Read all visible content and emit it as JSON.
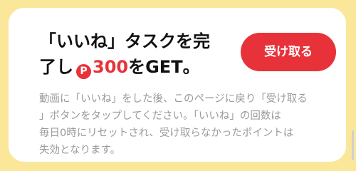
{
  "task": {
    "title_line1": "「いいね」タスクを完",
    "title_line2_prefix": "了し",
    "points_icon_glyph": "P",
    "points_value": "300",
    "title_line2_suffix": "をGET。",
    "claim_button_label": "受け取る",
    "description_lines": [
      "動画に「いいね」をした後、このページに戻り「受け取る",
      "」ボタンをタップしてください。「いいね」の回数は",
      "毎日0時にリセットされ、受け取らなかったポイントは",
      "失効となります。"
    ]
  },
  "colors": {
    "background": "#fbe79a",
    "card": "#ffffff",
    "accent": "#e8323a",
    "title_text": "#111111",
    "description_text": "#9a9a9a"
  },
  "icons": {
    "points": "points-coin-icon"
  }
}
